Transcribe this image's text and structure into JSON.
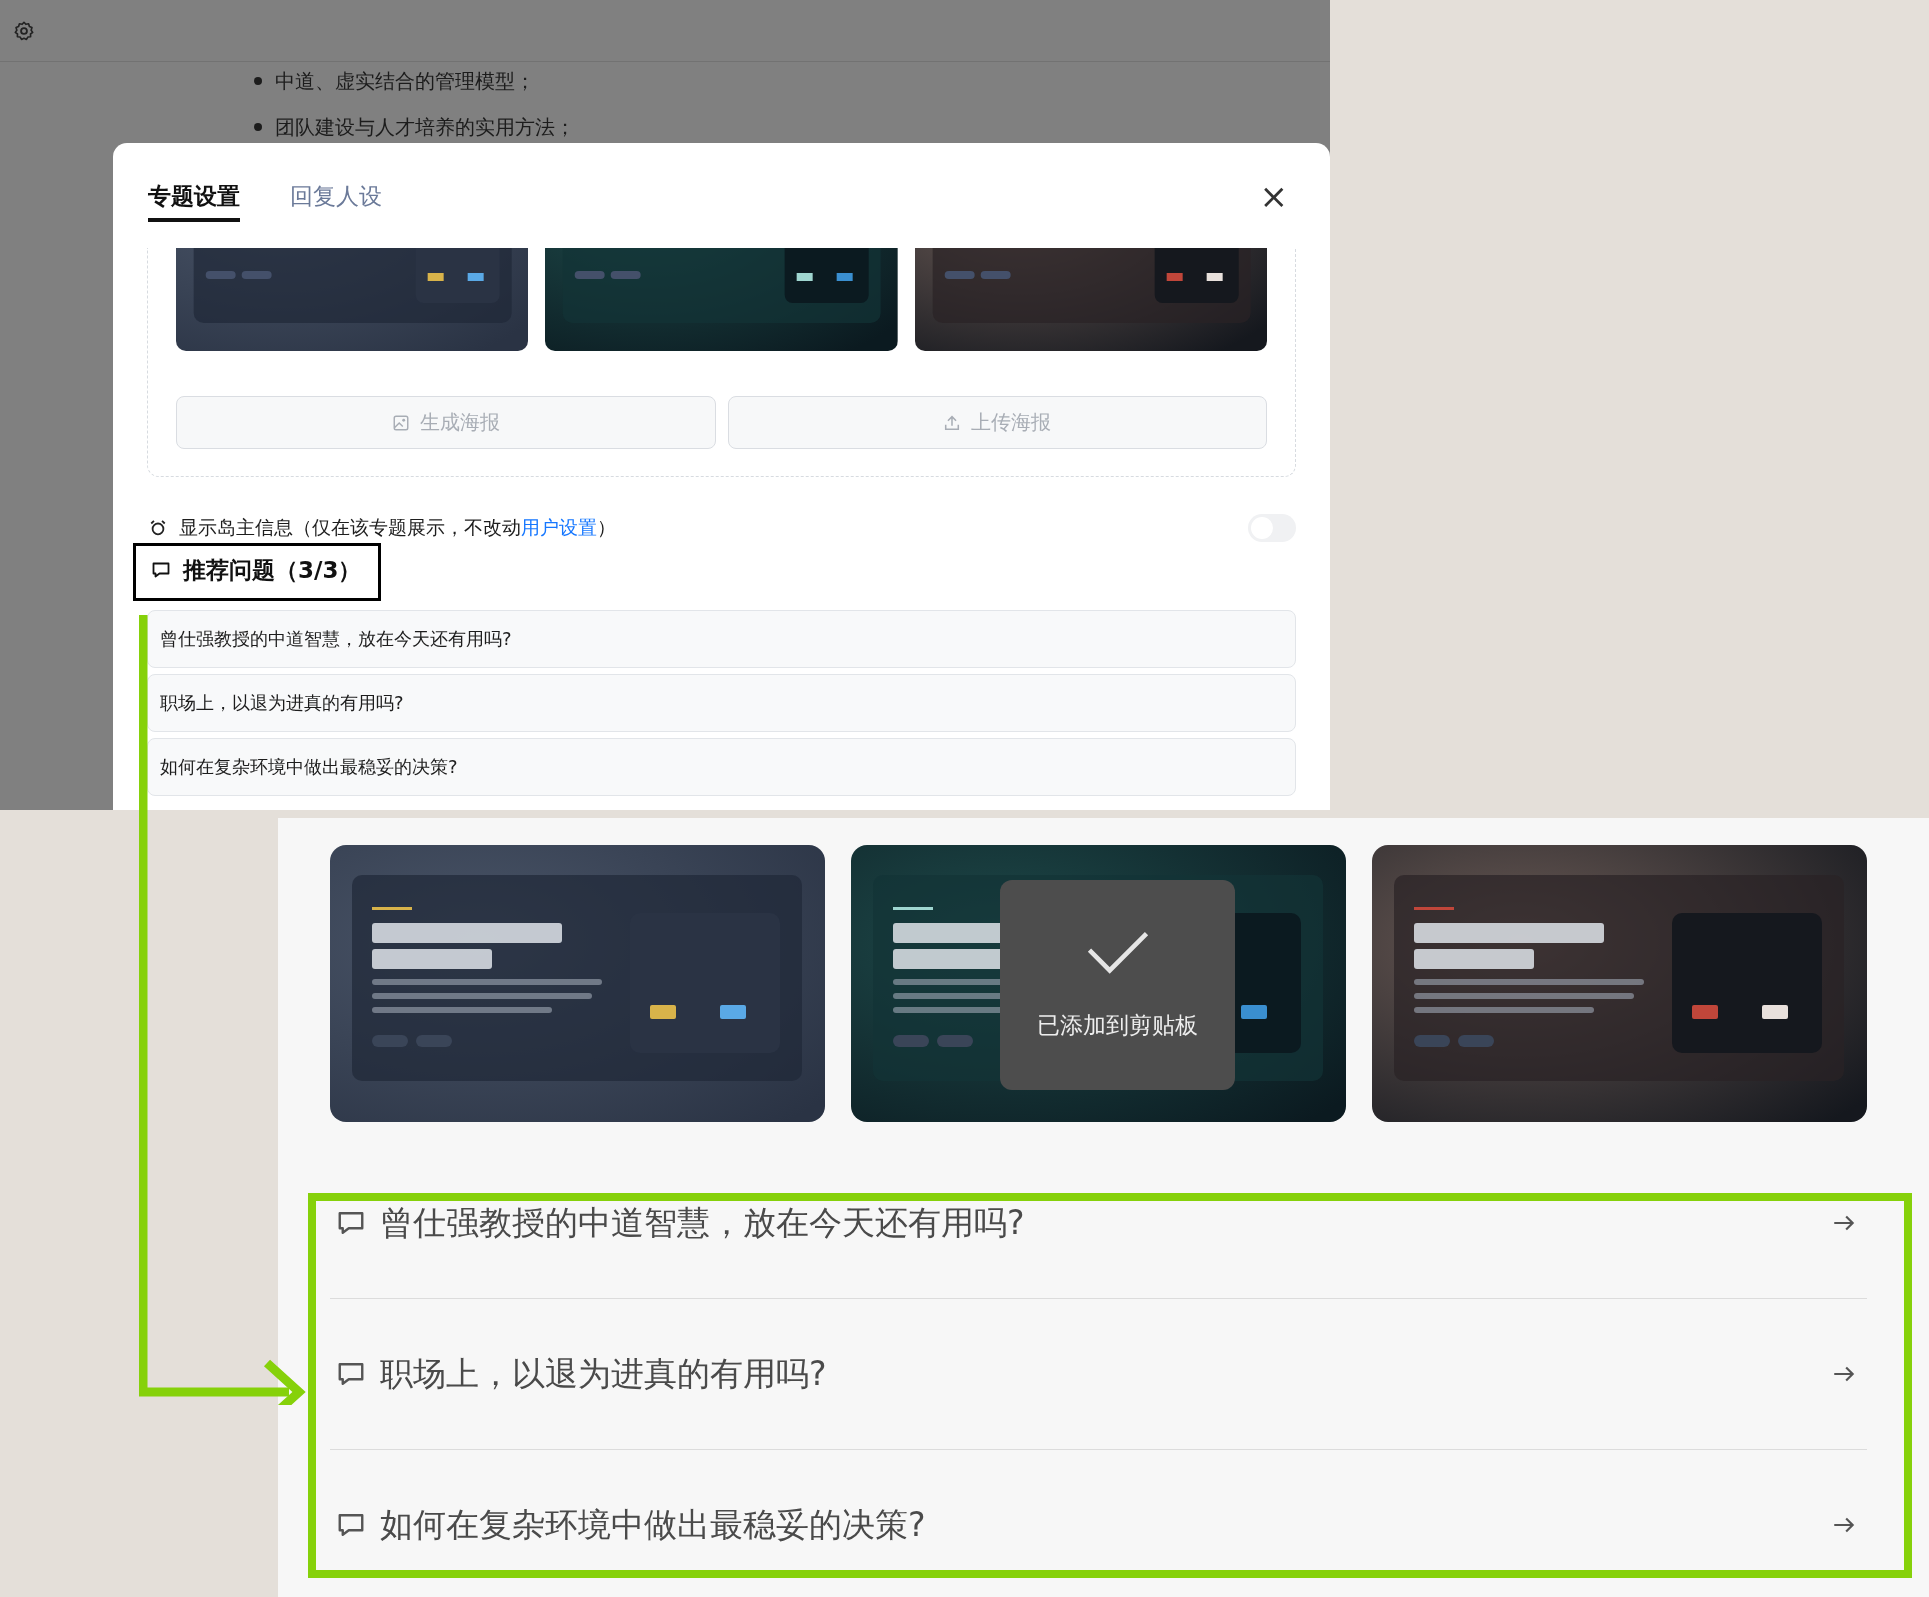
{
  "top_screenshot": {
    "background_list": [
      "中道、虚实结合的管理模型；",
      "团队建设与人才培养的实用方法；"
    ],
    "modal": {
      "tabs": [
        {
          "label": "专题设置",
          "selected": true
        },
        {
          "label": "回复人设",
          "selected": false
        }
      ],
      "close_label": "×",
      "poster_thumbnails": [
        {
          "kind": "picture"
        },
        {
          "kind": "picture"
        },
        {
          "kind": "picture"
        }
      ],
      "buttons": [
        {
          "kind": "generate",
          "label": "生成海报"
        },
        {
          "kind": "upload",
          "label": "上传海报"
        }
      ],
      "owner_info": {
        "text": "显示岛主信息（仅在该专题展示，不改动",
        "link": "用户设置",
        "suffix": "）",
        "on": false
      },
      "recommended": {
        "title": "推荐问题（3/3）",
        "questions": [
          "曾仕强教授的中道智慧，放在今天还有用吗?",
          "职场上，以退为进真的有用吗?",
          "如何在复杂环境中做出最稳妥的决策?"
        ]
      }
    }
  },
  "bottom_screenshot": {
    "posters": [
      {
        "kind": "picture"
      },
      {
        "kind": "picture",
        "toast": "已添加到剪贴板"
      },
      {
        "kind": "picture"
      }
    ],
    "questions": [
      "曾仕强教授的中道智慧，放在今天还有用吗?",
      "职场上，以退为进真的有用吗?",
      "如何在复杂环境中做出最稳妥的决策?"
    ]
  }
}
